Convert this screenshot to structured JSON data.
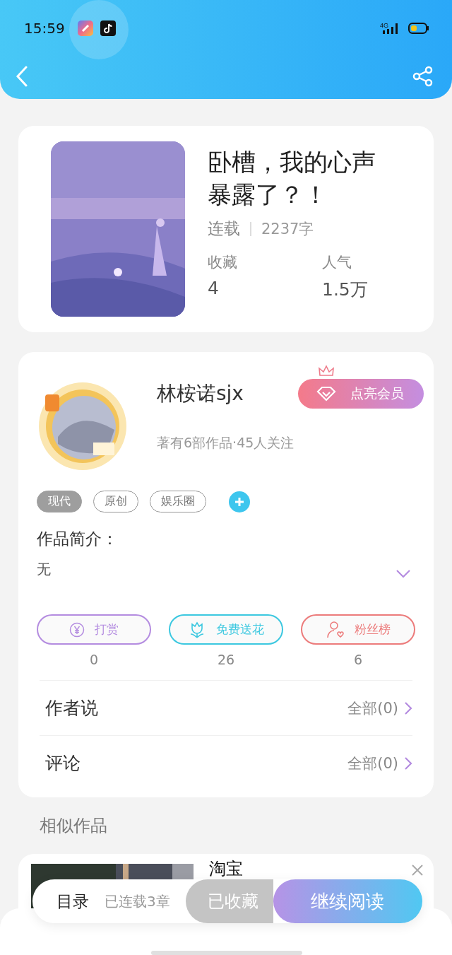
{
  "status_bar": {
    "time": "15:59",
    "network": "4G"
  },
  "book": {
    "title": "卧槽，我的心声暴露了？！",
    "status": "连载",
    "words": "2237字",
    "stats": [
      {
        "label": "收藏",
        "value": "4"
      },
      {
        "label": "人气",
        "value": "1.5万"
      }
    ]
  },
  "author": {
    "name": "林桉诺sjx",
    "vip_button": "点亮会员",
    "meta": "著有6部作品·45人关注"
  },
  "tags": [
    {
      "label": "现代",
      "selected": true
    },
    {
      "label": "原创",
      "selected": false
    },
    {
      "label": "娱乐圈",
      "selected": false
    }
  ],
  "intro": {
    "heading": "作品简介：",
    "text": "无"
  },
  "actions": [
    {
      "kind": "reward",
      "label": "打赏",
      "count": "0",
      "color": "#b48ce0"
    },
    {
      "kind": "flower",
      "label": "免费送花",
      "count": "26",
      "color": "#3cc8e0"
    },
    {
      "kind": "fans",
      "label": "粉丝榜",
      "count": "6",
      "color": "#ec7b7b"
    }
  ],
  "links": [
    {
      "label": "作者说",
      "value": "全部(0)"
    },
    {
      "label": "评论",
      "value": "全部(0)"
    }
  ],
  "similar": {
    "heading": "相似作品",
    "items": [
      {
        "title": "淘宝"
      }
    ]
  },
  "bottom_bar": {
    "catalog": "目录",
    "chapters": "已连载3章",
    "collect": "已收藏",
    "read": "继续阅读"
  }
}
